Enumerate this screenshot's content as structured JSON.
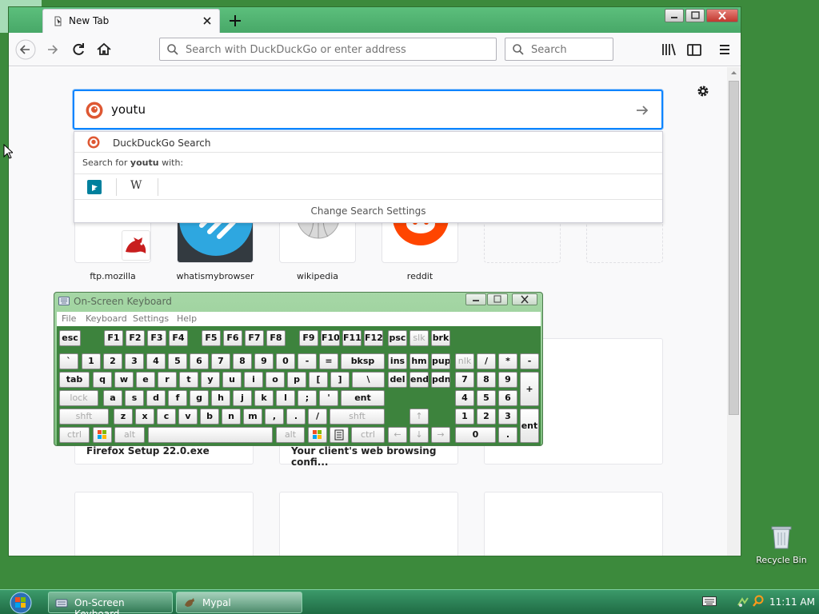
{
  "browser": {
    "tab": {
      "title": "New Tab"
    },
    "url_placeholder": "Search with DuckDuckGo or enter address",
    "search_placeholder": "Search"
  },
  "content": {
    "search_value": "youtu",
    "dropdown": {
      "suggestion": "DuckDuckGo Search",
      "search_for_prefix": "Search for ",
      "search_for_term": "youtu",
      "search_for_suffix": " with:",
      "wiki_glyph": "W",
      "settings_label": "Change Search Settings"
    },
    "top_sites": [
      {
        "label": "ftp.mozilla"
      },
      {
        "label": "whatismybrowser"
      },
      {
        "label": "wikipedia"
      },
      {
        "label": "reddit"
      }
    ],
    "highlights": [
      {
        "title": "Firefox Setup 22.0.exe"
      },
      {
        "title": "Your client's web browsing confi..."
      }
    ]
  },
  "osk": {
    "title": "On-Screen Keyboard",
    "menu": [
      "File",
      "Keyboard",
      "Settings",
      "Help"
    ],
    "keys": {
      "esc": "esc",
      "f1": "F1",
      "f2": "F2",
      "f3": "F3",
      "f4": "F4",
      "f5": "F5",
      "f6": "F6",
      "f7": "F7",
      "f8": "F8",
      "f9": "F9",
      "f10": "F10",
      "f11": "F11",
      "f12": "F12",
      "psc": "psc",
      "slk": "slk",
      "brk": "brk",
      "grave": "`",
      "n1": "1",
      "n2": "2",
      "n3": "3",
      "n4": "4",
      "n5": "5",
      "n6": "6",
      "n7": "7",
      "n8": "8",
      "n9": "9",
      "n0": "0",
      "minus": "-",
      "equals": "=",
      "bksp": "bksp",
      "ins": "ins",
      "hm": "hm",
      "pup": "pup",
      "nlk": "nlk",
      "slash": "/",
      "star": "*",
      "npminus": "-",
      "tab": "tab",
      "q": "q",
      "w": "w",
      "e": "e",
      "r": "r",
      "t": "t",
      "y": "y",
      "u": "u",
      "i": "i",
      "o": "o",
      "p": "p",
      "lbr": "[",
      "rbr": "]",
      "bslash": "\\",
      "del": "del",
      "end": "end",
      "pdn": "pdn",
      "np7": "7",
      "np8": "8",
      "np9": "9",
      "npplus": "+",
      "lock": "lock",
      "a": "a",
      "s": "s",
      "d": "d",
      "f": "f",
      "g": "g",
      "h": "h",
      "j": "j",
      "k": "k",
      "l": "l",
      "semi": ";",
      "quote": "'",
      "ent": "ent",
      "np4": "4",
      "np5": "5",
      "np6": "6",
      "shft": "shft",
      "z": "z",
      "x": "x",
      "c": "c",
      "v": "v",
      "b": "b",
      "n": "n",
      "m": "m",
      "comma": ",",
      "period": ".",
      "fslash": "/",
      "rshft": "shft",
      "up": "↑",
      "np1": "1",
      "np2": "2",
      "np3": "3",
      "npent": "ent",
      "ctrl": "ctrl",
      "alt": "alt",
      "ralt": "alt",
      "rctrl": "ctrl",
      "left": "←",
      "down": "↓",
      "right": "→",
      "np0": "0",
      "npdot": "."
    }
  },
  "desktop": {
    "recycle_bin": "Recycle Bin"
  },
  "taskbar": {
    "items": [
      {
        "label": "On-Screen Keyboard"
      },
      {
        "label": "Mypal"
      }
    ],
    "clock": "11:11 AM"
  },
  "colors": {
    "accent": "#0a84ff",
    "desktop": "#3c8a3c",
    "osk_keys_bg": "#3d833d"
  }
}
